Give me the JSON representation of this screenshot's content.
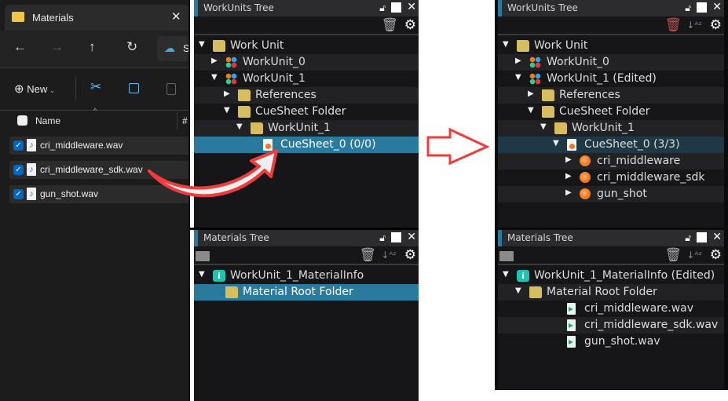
{
  "explorer": {
    "tab_title": "Materials",
    "nav_partial": "S",
    "new_label": "New",
    "column_name": "Name",
    "column_hash": "#",
    "files": [
      "cri_middleware.wav",
      "cri_middleware_sdk.wav",
      "gun_shot.wav"
    ]
  },
  "before": {
    "workunits_title": "WorkUnits Tree",
    "workunits_rows": [
      {
        "level": 0,
        "exp": "open",
        "icon": "folder-open",
        "label": "Work Unit"
      },
      {
        "level": 1,
        "exp": "closed",
        "icon": "workunit",
        "label": "WorkUnit_0"
      },
      {
        "level": 1,
        "exp": "open",
        "icon": "workunit",
        "label": "WorkUnit_1"
      },
      {
        "level": 2,
        "exp": "closed",
        "icon": "folder",
        "label": "References"
      },
      {
        "level": 2,
        "exp": "open",
        "icon": "folder-open",
        "label": "CueSheet Folder"
      },
      {
        "level": 3,
        "exp": "open",
        "icon": "folder-open",
        "label": "WorkUnit_1"
      },
      {
        "level": 4,
        "exp": "none",
        "icon": "cuesheet",
        "label": "CueSheet_0 (0/0)",
        "state": "sel"
      }
    ],
    "materials_title": "Materials Tree",
    "materials_rows": [
      {
        "level": 0,
        "exp": "open",
        "icon": "info",
        "label": "WorkUnit_1_MaterialInfo"
      },
      {
        "level": 1,
        "exp": "none",
        "icon": "folder-open",
        "label": "Material Root Folder",
        "state": "sel"
      }
    ]
  },
  "after": {
    "workunits_title": "WorkUnits Tree",
    "workunits_rows": [
      {
        "level": 0,
        "exp": "open",
        "icon": "folder-open",
        "label": "Work Unit"
      },
      {
        "level": 1,
        "exp": "closed",
        "icon": "workunit",
        "label": "WorkUnit_0"
      },
      {
        "level": 1,
        "exp": "open",
        "icon": "workunit",
        "label": "WorkUnit_1 (Edited)"
      },
      {
        "level": 2,
        "exp": "closed",
        "icon": "folder",
        "label": "References"
      },
      {
        "level": 2,
        "exp": "open",
        "icon": "folder-open",
        "label": "CueSheet Folder"
      },
      {
        "level": 3,
        "exp": "open",
        "icon": "folder-open",
        "label": "WorkUnit_1"
      },
      {
        "level": 4,
        "exp": "open",
        "icon": "cuesheet",
        "label": "CueSheet_0 (3/3)",
        "state": "dim"
      },
      {
        "level": 5,
        "exp": "closed",
        "icon": "cue",
        "label": "cri_middleware"
      },
      {
        "level": 5,
        "exp": "closed",
        "icon": "cue",
        "label": "cri_middleware_sdk"
      },
      {
        "level": 5,
        "exp": "closed",
        "icon": "cue",
        "label": "gun_shot"
      }
    ],
    "materials_title": "Materials Tree",
    "materials_rows": [
      {
        "level": 0,
        "exp": "open",
        "icon": "info",
        "label": "WorkUnit_1_MaterialInfo (Edited)"
      },
      {
        "level": 1,
        "exp": "open",
        "icon": "folder-open",
        "label": "Material Root Folder"
      },
      {
        "level": 4,
        "exp": "none",
        "icon": "wav",
        "label": "cri_middleware.wav"
      },
      {
        "level": 4,
        "exp": "none",
        "icon": "wav",
        "label": "cri_middleware_sdk.wav"
      },
      {
        "level": 4,
        "exp": "none",
        "icon": "wav",
        "label": "gun_shot.wav"
      }
    ]
  },
  "colors": {
    "selection": "#2a7a9e",
    "arrow": "#f03c3c",
    "trash_active": "#c0504d"
  }
}
